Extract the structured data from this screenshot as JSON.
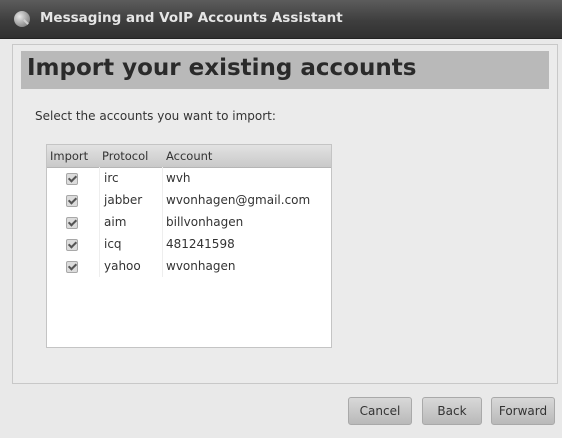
{
  "window": {
    "title": "Messaging and VoIP Accounts Assistant"
  },
  "page": {
    "title": "Import your existing accounts",
    "instruction": "Select the accounts you want to import:"
  },
  "table": {
    "columns": [
      "Import",
      "Protocol",
      "Account"
    ],
    "rows": [
      {
        "import": true,
        "protocol": "irc",
        "account": "wvh"
      },
      {
        "import": true,
        "protocol": "jabber",
        "account": "wvonhagen@gmail.com"
      },
      {
        "import": true,
        "protocol": "aim",
        "account": "billvonhagen"
      },
      {
        "import": true,
        "protocol": "icq",
        "account": "481241598"
      },
      {
        "import": true,
        "protocol": "yahoo",
        "account": "wvonhagen"
      }
    ]
  },
  "buttons": {
    "cancel": "Cancel",
    "back": "Back",
    "forward": "Forward"
  }
}
